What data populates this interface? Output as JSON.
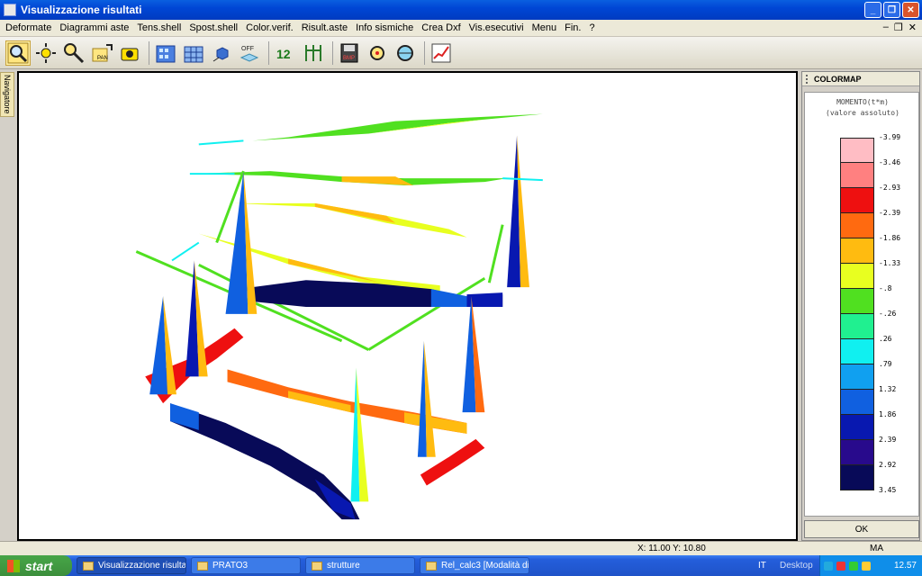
{
  "window": {
    "title": "Visualizzazione risultati"
  },
  "menu": [
    "Deformate",
    "Diagrammi aste",
    "Tens.shell",
    "Spost.shell",
    "Color.verif.",
    "Risult.aste",
    "Info sismiche",
    "Crea Dxf",
    "Vis.esecutivi",
    "Menu",
    "Fin.",
    "?"
  ],
  "toolbar": {
    "icons": [
      "zoom-window-icon",
      "zoom-sun-icon",
      "zoom-out-icon",
      "pan-icon",
      "camera-icon",
      "building-view-icon",
      "building-frame-icon",
      "cube-axes-icon",
      "off-icon",
      "numbers-icon",
      "frame-axes-icon",
      "save-bmp-icon",
      "inspect-icon",
      "inspect-zoom-icon",
      "chart-icon"
    ],
    "off_label": "OFF",
    "pan_label": "PAN",
    "bmp_label": "BMP"
  },
  "navigator": {
    "label": "Navigatore"
  },
  "colormap": {
    "header": "COLORMAP",
    "title_line1": "MOMENTO(t*m)",
    "title_line2": "(valore assoluto)",
    "ticks": [
      "-3.99",
      "-3.46",
      "-2.93",
      "-2.39",
      "-1.86",
      "-1.33",
      "-.8",
      "-.26",
      ".26",
      ".79",
      "1.32",
      "1.86",
      "2.39",
      "2.92",
      "3.45"
    ],
    "colors": [
      "#ffbdc4",
      "#ff8080",
      "#ee1010",
      "#ff6a10",
      "#ffbb10",
      "#e8ff20",
      "#50e020",
      "#20f090",
      "#10f0f0",
      "#10a0f0",
      "#1060e0",
      "#0818b0",
      "#280a8c",
      "#080a58"
    ],
    "ok_label": "OK"
  },
  "status": {
    "coords": "X: 11.00  Y: 10.80",
    "mode": "MA"
  },
  "taskbar": {
    "start": "start",
    "tasks": [
      "Visualizzazione risultati",
      "PRATO3",
      "strutture",
      "Rel_calc3 [Modalità di..."
    ],
    "lang": "IT",
    "desktop": "Desktop",
    "clock": "12.57"
  }
}
